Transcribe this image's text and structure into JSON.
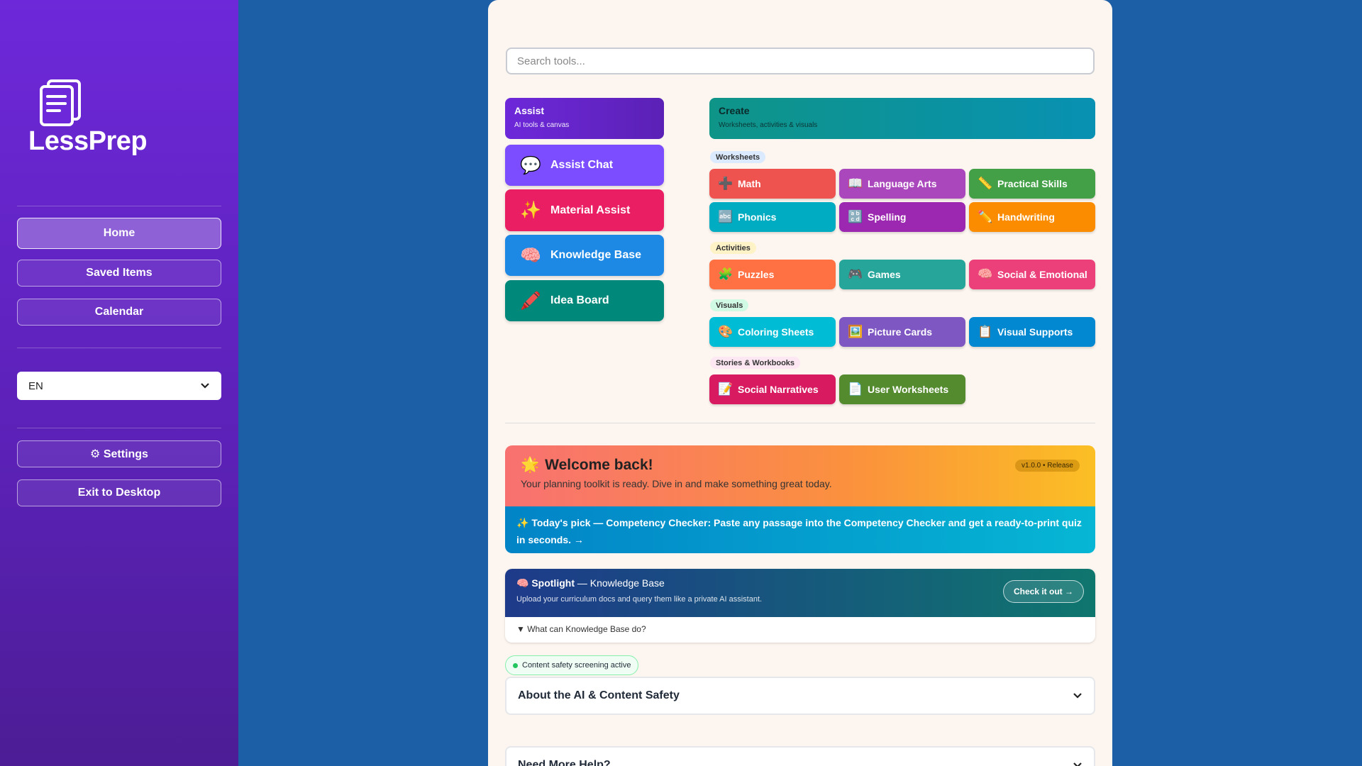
{
  "app": {
    "name": "LessPrep"
  },
  "sidebar": {
    "nav": [
      {
        "label": "Home",
        "active": true
      },
      {
        "label": "Saved Items"
      },
      {
        "label": "Calendar"
      }
    ],
    "language": "EN",
    "settings_label": "⚙ Settings",
    "exit_label": "Exit to Desktop"
  },
  "search": {
    "placeholder": "Search tools..."
  },
  "assist": {
    "title": "Assist",
    "subtitle": "AI tools & canvas",
    "items": [
      {
        "label": "Assist Chat",
        "icon": "💬",
        "color": "#7c4dff"
      },
      {
        "label": "Material Assist",
        "icon": "✨",
        "color": "#e91e63"
      },
      {
        "label": "Knowledge Base",
        "icon": "🧠",
        "color": "#1e88e5"
      },
      {
        "label": "Idea Board",
        "icon": "🖍️",
        "color": "#00897b"
      }
    ]
  },
  "create": {
    "title": "Create",
    "subtitle": "Worksheets, activities & visuals",
    "sections": {
      "worksheets": "Worksheets",
      "activities": "Activities",
      "visuals": "Visuals",
      "stories": "Stories & Workbooks"
    },
    "tools": {
      "math": "Math",
      "language_arts": "Language Arts",
      "practical_skills": "Practical Skills",
      "phonics": "Phonics",
      "spelling": "Spelling",
      "handwriting": "Handwriting",
      "puzzles": "Puzzles",
      "games": "Games",
      "social_emotional": "Social & Emotional",
      "coloring_sheets": "Coloring Sheets",
      "picture_cards": "Picture Cards",
      "visual_supports": "Visual Supports",
      "social_narratives": "Social Narratives",
      "user_worksheets": "User Worksheets"
    }
  },
  "welcome": {
    "icon": "🌟",
    "title": "Welcome back!",
    "subtitle": "Your planning toolkit is ready. Dive in and make something great today.",
    "version": "v1.0.0 • Release",
    "pick": "✨ Today's pick — Competency Checker: Paste any passage into the Competency Checker and get a ready-to-print quiz in seconds. →"
  },
  "spotlight": {
    "icon": "🧠",
    "label": "Spotlight",
    "title": " — Knowledge Base",
    "subtitle": "Upload your curriculum docs and query them like a private AI assistant.",
    "button": "Check it out →",
    "details": "▼  What can Knowledge Base do?"
  },
  "safety": {
    "badge": "Content safety screening active"
  },
  "accordions": {
    "ai_safety": "About the AI & Content Safety",
    "help": "Need More Help?"
  }
}
